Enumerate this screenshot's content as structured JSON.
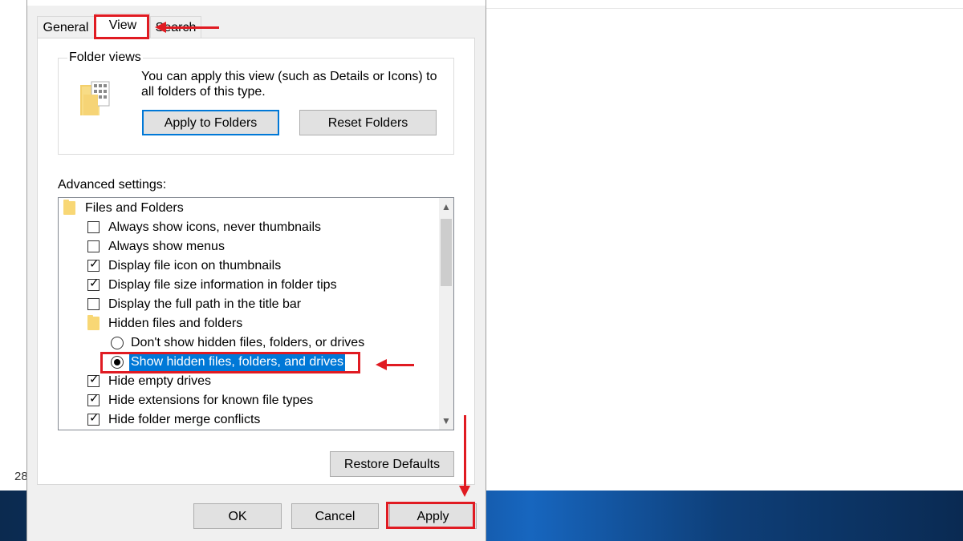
{
  "background": {
    "status_fragment": "28"
  },
  "dialog": {
    "tabs": [
      {
        "label": "General"
      },
      {
        "label": "View"
      },
      {
        "label": "Search"
      }
    ],
    "folder_views": {
      "legend": "Folder views",
      "description": "You can apply this view (such as Details or Icons) to all folders of this type.",
      "apply_button": "Apply to Folders",
      "reset_button": "Reset Folders"
    },
    "advanced_settings": {
      "label": "Advanced settings:",
      "items": [
        {
          "type": "folder",
          "label": "Files and Folders"
        },
        {
          "type": "checkbox",
          "label": "Always show icons, never thumbnails",
          "checked": false
        },
        {
          "type": "checkbox",
          "label": "Always show menus",
          "checked": false
        },
        {
          "type": "checkbox",
          "label": "Display file icon on thumbnails",
          "checked": true
        },
        {
          "type": "checkbox",
          "label": "Display file size information in folder tips",
          "checked": true
        },
        {
          "type": "checkbox",
          "label": "Display the full path in the title bar",
          "checked": false
        },
        {
          "type": "folder",
          "label": "Hidden files and folders"
        },
        {
          "type": "radio",
          "label": "Don't show hidden files, folders, or drives",
          "checked": false
        },
        {
          "type": "radio",
          "label": "Show hidden files, folders, and drives",
          "checked": true,
          "selected": true
        },
        {
          "type": "checkbox",
          "label": "Hide empty drives",
          "checked": true
        },
        {
          "type": "checkbox",
          "label": "Hide extensions for known file types",
          "checked": true
        },
        {
          "type": "checkbox",
          "label": "Hide folder merge conflicts",
          "checked": true
        }
      ]
    },
    "restore_defaults": "Restore Defaults",
    "buttons": {
      "ok": "OK",
      "cancel": "Cancel",
      "apply": "Apply"
    }
  },
  "colors": {
    "annotation": "#e01b22",
    "selection": "#0078d7",
    "taskbar": "#1766bf"
  }
}
